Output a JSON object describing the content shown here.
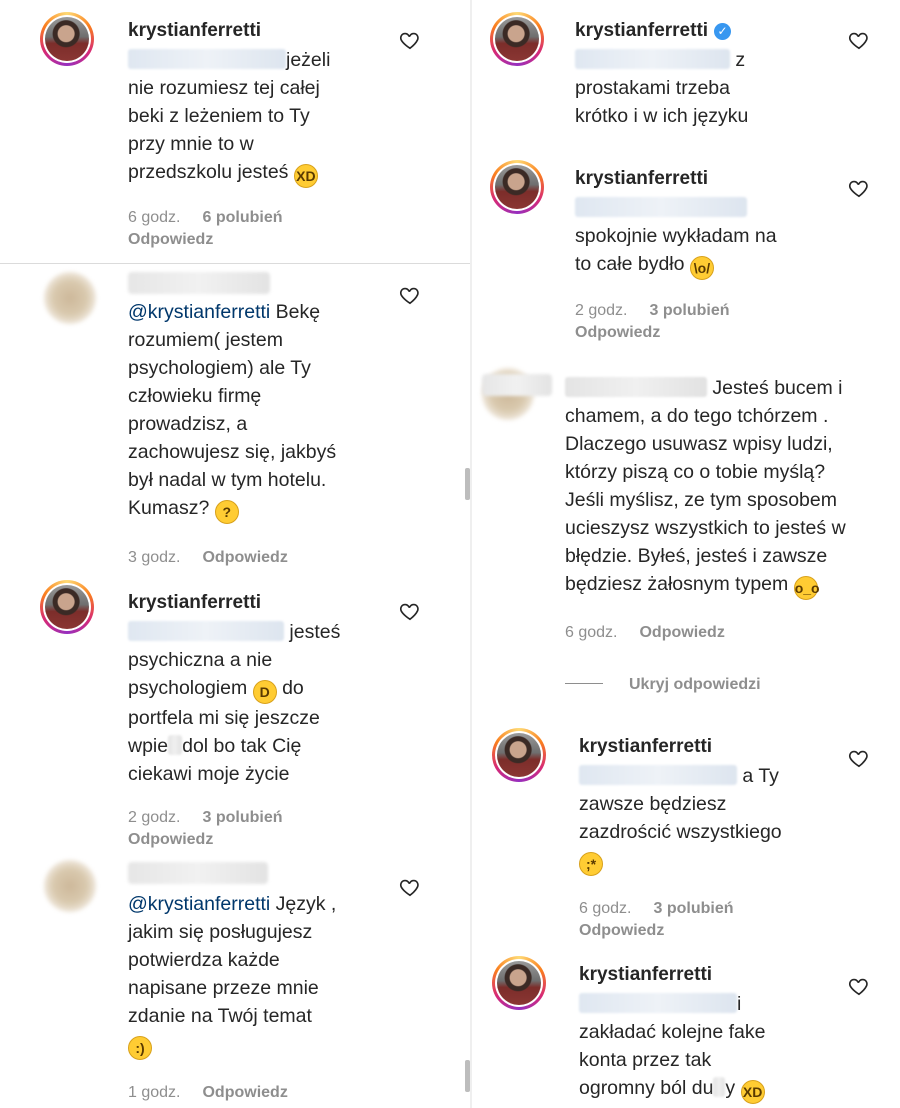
{
  "common": {
    "reply_label": "Odpowiedz",
    "hide_replies_label": "Ukryj odpowiedzi"
  },
  "left": [
    {
      "username": "krystianferretti",
      "lines": [
        "jeżeli",
        "nie rozumiesz tej całej",
        "beki z leżeniem to Ty",
        "przy mnie to w",
        "przedszkolu jesteś"
      ],
      "emoji": "rolling-on-floor-laughing",
      "time": "6 godz.",
      "likes": "6 polubień"
    },
    {
      "mention": "@krystianferretti",
      "lines": [
        "Bekę",
        "rozumiem( jestem",
        "psychologiem) ale Ty",
        "człowieku firmę",
        "prowadzisz, a",
        "zachowujesz się, jakbyś",
        "był nadal w tym hotelu.",
        "Kumasz?"
      ],
      "emoji": "thinking-face",
      "time": "3 godz."
    },
    {
      "username": "krystianferretti",
      "lines": [
        "jesteś",
        "psychiczna a nie",
        "psychologiem",
        "do",
        "portfela mi się jeszcze",
        "wpie",
        "dol bo tak Cię",
        "ciekawi moje życie"
      ],
      "emoji": "face-with-tears-of-joy",
      "time": "2 godz.",
      "likes": "3 polubień"
    },
    {
      "mention": "@krystianferretti",
      "lines": [
        "Język ,",
        "jakim się posługujesz",
        "potwierdza każde",
        "napisane przeze mnie",
        "zdanie na Twój temat"
      ],
      "emoji": "smiling-face",
      "time": "1 godz."
    }
  ],
  "right": [
    {
      "username": "krystianferretti",
      "verified": true,
      "lines": [
        "z",
        "prostakami trzeba",
        "krótko i w ich języku"
      ]
    },
    {
      "username": "krystianferretti",
      "lines": [
        "spokojnie wykładam na",
        "to całe bydło"
      ],
      "emoji": "person-raising-hands",
      "time": "2 godz.",
      "likes": "3 polubień"
    },
    {
      "lines": [
        "Jesteś bucem i",
        "chamem, a do tego tchórzem .",
        "Dlaczego usuwasz wpisy ludzi,",
        "którzy piszą co o tobie myślą?",
        "Jeśli myślisz, ze tym sposobem",
        "ucieszysz wszystkich to jesteś w",
        "błędzie. Byłeś, jesteś i zawsze",
        "będziesz żałosnym typem"
      ],
      "emoji": "face-with-rolling-eyes",
      "time": "6 godz."
    },
    {
      "username": "krystianferretti",
      "lines": [
        "a Ty",
        "zawsze będziesz",
        "zazdrościć wszystkiego"
      ],
      "emoji": "face-blowing-kiss",
      "time": "6 godz.",
      "likes": "3 polubień"
    },
    {
      "username": "krystianferretti",
      "lines": [
        "i",
        "zakładać kolejne fake",
        "konta przez tak",
        "ogromny ból du",
        "y"
      ],
      "emoji": "grinning-squinting-face"
    }
  ],
  "icons": {
    "like": "heart-outline-icon",
    "verified": "verified-badge-icon"
  },
  "colors": {
    "text": "#262626",
    "meta": "#8e8e8e",
    "mention": "#00376b",
    "verified": "#3897f0"
  }
}
